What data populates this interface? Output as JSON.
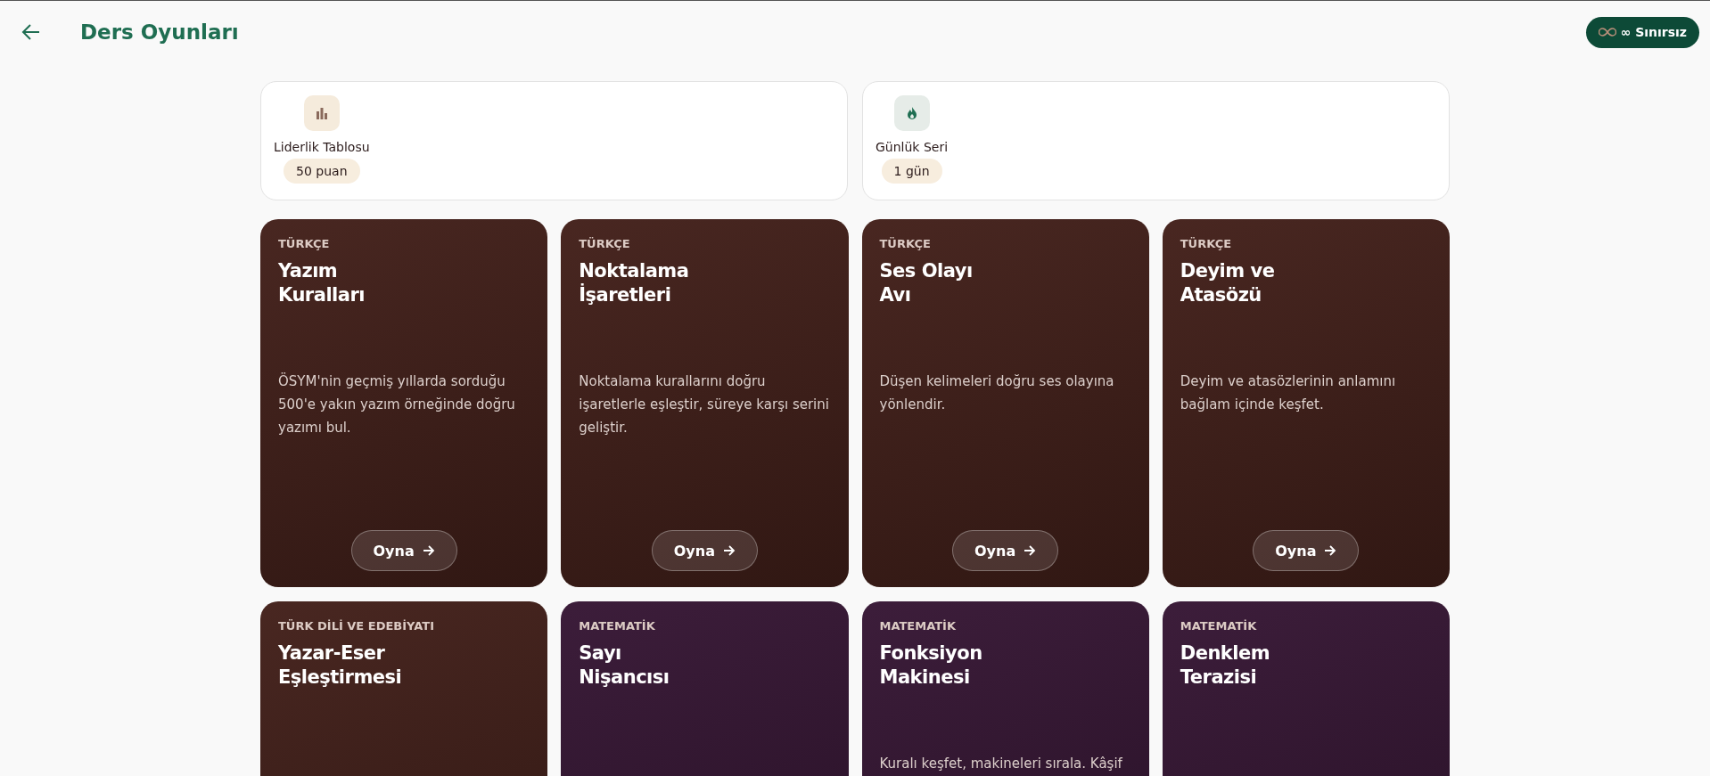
{
  "header": {
    "title": "Ders Oyunları",
    "badge": "∞ Sınırsız"
  },
  "stats": [
    {
      "kind": "leaderboard",
      "label": "Liderlik Tablosu",
      "value": "50 puan"
    },
    {
      "kind": "streak",
      "label": "Günlük Seri",
      "value": "1 gün"
    }
  ],
  "games": [
    {
      "category": "TÜRKÇE",
      "title_lines": [
        "Yazım",
        "Kuralları"
      ],
      "description": "ÖSYM'nin geçmiş yıllarda sorduğu 500'e yakın yazım örneğinde doğru yazımı bul.",
      "button": "Oyna",
      "color": "#43201a"
    },
    {
      "category": "TÜRKÇE",
      "title_lines": [
        "Noktalama",
        "İşaretleri"
      ],
      "description": "Noktalama kurallarını doğru işaretlerle eşleştir, süreye karşı serini geliştir.",
      "button": "Oyna",
      "color": "#43201a"
    },
    {
      "category": "TÜRKÇE",
      "title_lines": [
        "Ses Olayı",
        "Avı"
      ],
      "description": "Düşen kelimeleri doğru ses olayına yönlendir.",
      "button": "Oyna",
      "color": "#43201a"
    },
    {
      "category": "TÜRKÇE",
      "title_lines": [
        "Deyim ve",
        "Atasözü"
      ],
      "description": "Deyim ve atasözlerinin anlamını bağlam içinde keşfet.",
      "button": "Oyna",
      "color": "#43201a"
    },
    {
      "category": "TÜRK DİLİ VE EDEBİYATI",
      "title_lines": [
        "Yazar-Eser",
        "Eşleştirmesi"
      ],
      "color": "#43201a"
    },
    {
      "category": "MATEMATİK",
      "title_lines": [
        "Sayı",
        "Nişancısı"
      ],
      "color": "#361634"
    },
    {
      "category": "MATEMATİK",
      "title_lines": [
        "Fonksiyon",
        "Makinesi"
      ],
      "description": "Kuralı keşfet, makineleri sırala. Kâşif",
      "color": "#361634"
    },
    {
      "category": "MATEMATİK",
      "title_lines": [
        "Denklem",
        "Terazisi"
      ],
      "color": "#361634"
    }
  ]
}
